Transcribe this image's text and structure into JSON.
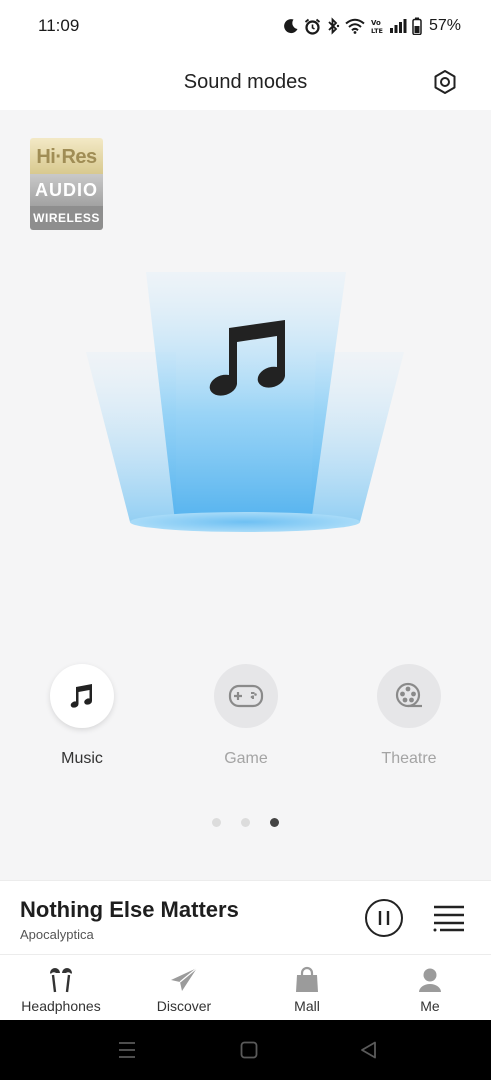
{
  "status_bar": {
    "time": "11:09",
    "battery": "57%",
    "icons": [
      "moon-icon",
      "alarm-icon",
      "bluetooth-icon",
      "wifi-icon",
      "volte-icon",
      "signal-icon",
      "battery-icon"
    ]
  },
  "header": {
    "title": "Sound modes",
    "settings_icon": "gear-icon"
  },
  "badge": {
    "line1": "Hi·Res",
    "line2": "AUDIO",
    "line3": "WIRELESS"
  },
  "hero": {
    "icon": "music-note-icon"
  },
  "modes": [
    {
      "label": "Music",
      "icon": "music-note-icon",
      "active": true
    },
    {
      "label": "Game",
      "icon": "gamepad-icon",
      "active": false
    },
    {
      "label": "Theatre",
      "icon": "film-reel-icon",
      "active": false
    }
  ],
  "pager": {
    "total": 3,
    "current": 3
  },
  "player": {
    "title": "Nothing Else Matters",
    "artist": "Apocalyptica",
    "state": "playing"
  },
  "tabs": [
    {
      "label": "Headphones",
      "icon": "earbuds-icon"
    },
    {
      "label": "Discover",
      "icon": "paper-plane-icon"
    },
    {
      "label": "Mall",
      "icon": "shopping-bag-icon"
    },
    {
      "label": "Me",
      "icon": "user-icon"
    }
  ],
  "colors": {
    "accent_blue": "#5ab8f0",
    "background": "#f5f5f6"
  }
}
